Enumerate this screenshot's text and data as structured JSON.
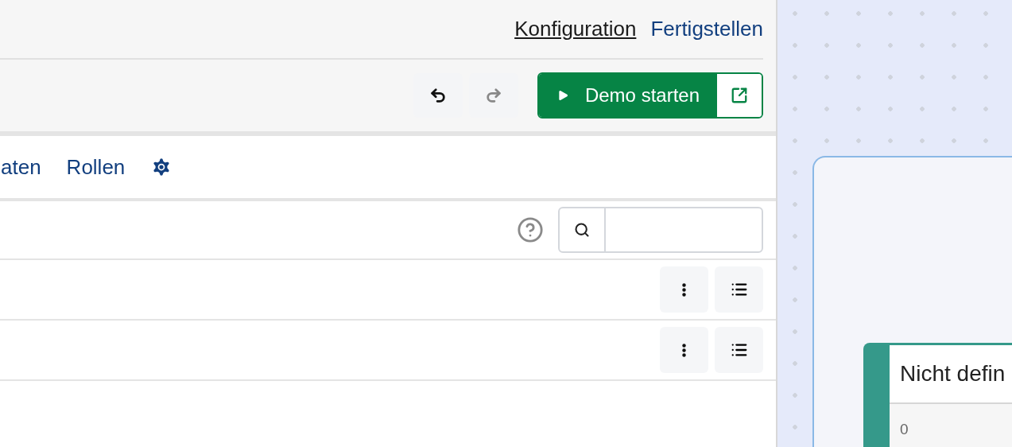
{
  "header": {
    "links": [
      {
        "label": "Konfiguration",
        "hovered": true
      },
      {
        "label": "Fertigstellen",
        "hovered": false
      }
    ]
  },
  "toolbar": {
    "undo": {
      "disabled": false
    },
    "redo": {
      "disabled": true
    },
    "demo_button": {
      "label": "Demo starten"
    }
  },
  "tabs": [
    {
      "kind": "text",
      "label": "aten"
    },
    {
      "kind": "text",
      "label": "Rollen"
    },
    {
      "kind": "gear"
    }
  ],
  "rows": [
    {
      "kind": "actions"
    },
    {
      "kind": "actions"
    }
  ],
  "canvas": {
    "node": {
      "title": "Nicht defin",
      "value": "0",
      "color": "#35998a"
    }
  }
}
